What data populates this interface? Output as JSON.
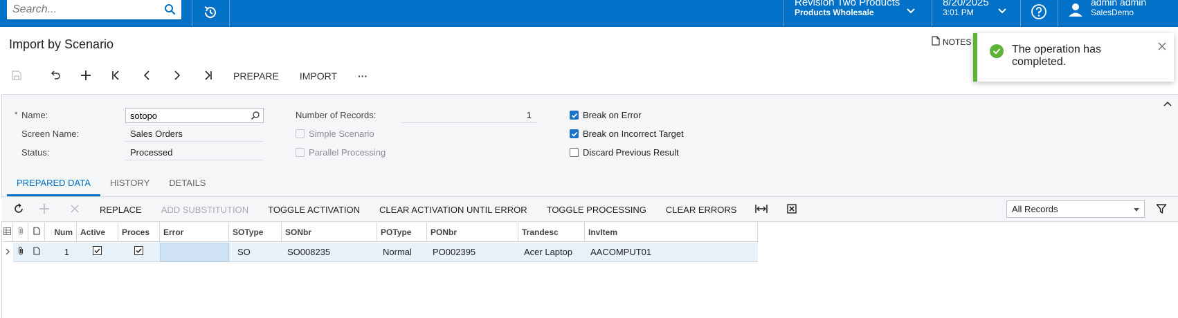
{
  "topbar": {
    "search_placeholder": "Search...",
    "tenant_name": "Revision Two Products",
    "tenant_branch": "Products Wholesale",
    "date": "8/20/2025",
    "time": "3:01 PM",
    "user_name": "admin admin",
    "user_company": "SalesDemo",
    "bar_color": "#0071c6"
  },
  "page": {
    "title": "Import by Scenario",
    "notes_label": "NOTES",
    "toolbar": {
      "prepare_label": "PREPARE",
      "import_label": "IMPORT",
      "more_label": "···"
    }
  },
  "toast": {
    "message": "The operation has completed.",
    "accent_color": "#5cb335"
  },
  "form": {
    "name_required_mark": "*",
    "name_label": "Name:",
    "name_value": "sotopo",
    "screen_name_label": "Screen Name:",
    "screen_name_value": "Sales Orders",
    "status_label": "Status:",
    "status_value": "Processed",
    "records_label": "Number of Records:",
    "records_value": "1",
    "simple_scenario_label": "Simple Scenario",
    "simple_scenario_checked": false,
    "parallel_processing_label": "Parallel Processing",
    "parallel_processing_checked": false,
    "break_on_error_label": "Break on Error",
    "break_on_error_checked": true,
    "break_on_target_label": "Break on Incorrect Target",
    "break_on_target_checked": true,
    "discard_label": "Discard Previous Result",
    "discard_checked": false
  },
  "tabs": [
    {
      "label": "PREPARED DATA",
      "active": true
    },
    {
      "label": "HISTORY",
      "active": false
    },
    {
      "label": "DETAILS",
      "active": false
    }
  ],
  "grid_toolbar": {
    "replace_label": "REPLACE",
    "add_substitution_label": "ADD SUBSTITUTION",
    "toggle_activation_label": "TOGGLE ACTIVATION",
    "clear_activation_label": "CLEAR ACTIVATION UNTIL ERROR",
    "toggle_processing_label": "TOGGLE PROCESSING",
    "clear_errors_label": "CLEAR ERRORS",
    "filter_value": "All Records"
  },
  "grid": {
    "columns": [
      "Num",
      "Active",
      "Proces",
      "Error",
      "SOType",
      "SONbr",
      "POType",
      "PONbr",
      "Trandesc",
      "InvItem"
    ],
    "rows": [
      {
        "num": "1",
        "active": true,
        "processed": true,
        "error": "",
        "sotype": "SO",
        "sonbr": "SO008235",
        "potype": "Normal",
        "ponbr": "PO002395",
        "trandesc": "Acer Laptop",
        "invitem": "AACOMPUT01"
      }
    ]
  }
}
